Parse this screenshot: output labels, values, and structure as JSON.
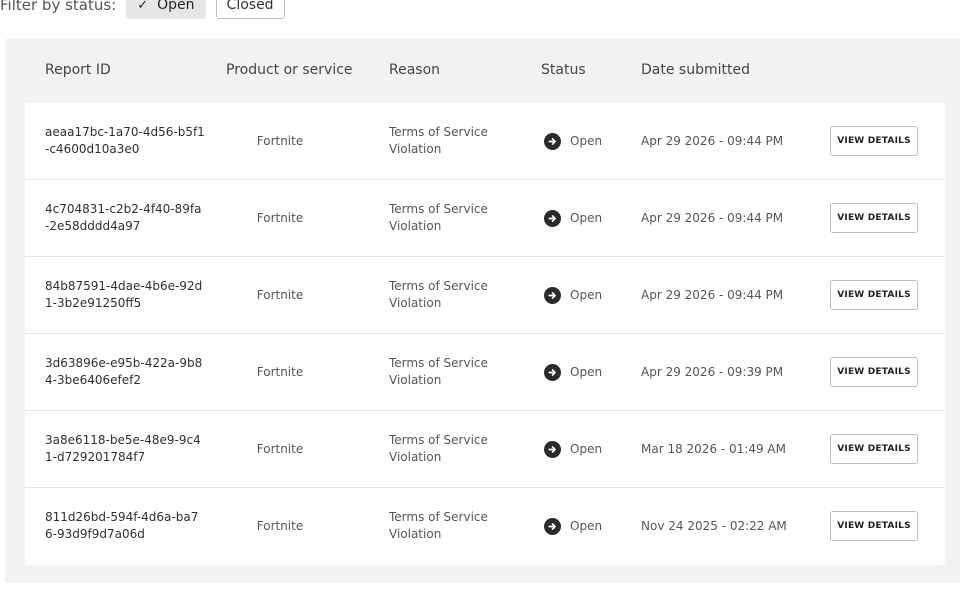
{
  "filter": {
    "label": "Filter by status:",
    "options": [
      {
        "label": "Open",
        "selected": true
      },
      {
        "label": "Closed",
        "selected": false
      }
    ]
  },
  "table": {
    "columns": [
      "Report ID",
      "Product or service",
      "Reason",
      "Status",
      "Date submitted"
    ],
    "action_label": "VIEW DETAILS",
    "rows": [
      {
        "id": "aeaa17bc-1a70-4d56-b5f1-c4600d10a3e0",
        "product": "Fortnite",
        "reason": "Terms of Service Violation",
        "status": "Open",
        "date": "Apr 29 2026 - 09:44 PM"
      },
      {
        "id": "4c704831-c2b2-4f40-89fa-2e58dddd4a97",
        "product": "Fortnite",
        "reason": "Terms of Service Violation",
        "status": "Open",
        "date": "Apr 29 2026 - 09:44 PM"
      },
      {
        "id": "84b87591-4dae-4b6e-92d1-3b2e91250ff5",
        "product": "Fortnite",
        "reason": "Terms of Service Violation",
        "status": "Open",
        "date": "Apr 29 2026 - 09:44 PM"
      },
      {
        "id": "3d63896e-e95b-422a-9b84-3be6406efef2",
        "product": "Fortnite",
        "reason": "Terms of Service Violation",
        "status": "Open",
        "date": "Apr 29 2026 - 09:39 PM"
      },
      {
        "id": "3a8e6118-be5e-48e9-9c41-d729201784f7",
        "product": "Fortnite",
        "reason": "Terms of Service Violation",
        "status": "Open",
        "date": "Mar 18 2026 - 01:49 AM"
      },
      {
        "id": "811d26bd-594f-4d6a-ba76-93d9f9d7a06d",
        "product": "Fortnite",
        "reason": "Terms of Service Violation",
        "status": "Open",
        "date": "Nov 24 2025 - 02:22 AM"
      }
    ]
  },
  "icons": {
    "status_open": "arrow-right-circle-icon",
    "selected_check": "check-icon"
  },
  "colors": {
    "panel_bg": "#f2f2f2",
    "row_bg": "#ffffff",
    "status_icon": "#2b2b2b"
  }
}
